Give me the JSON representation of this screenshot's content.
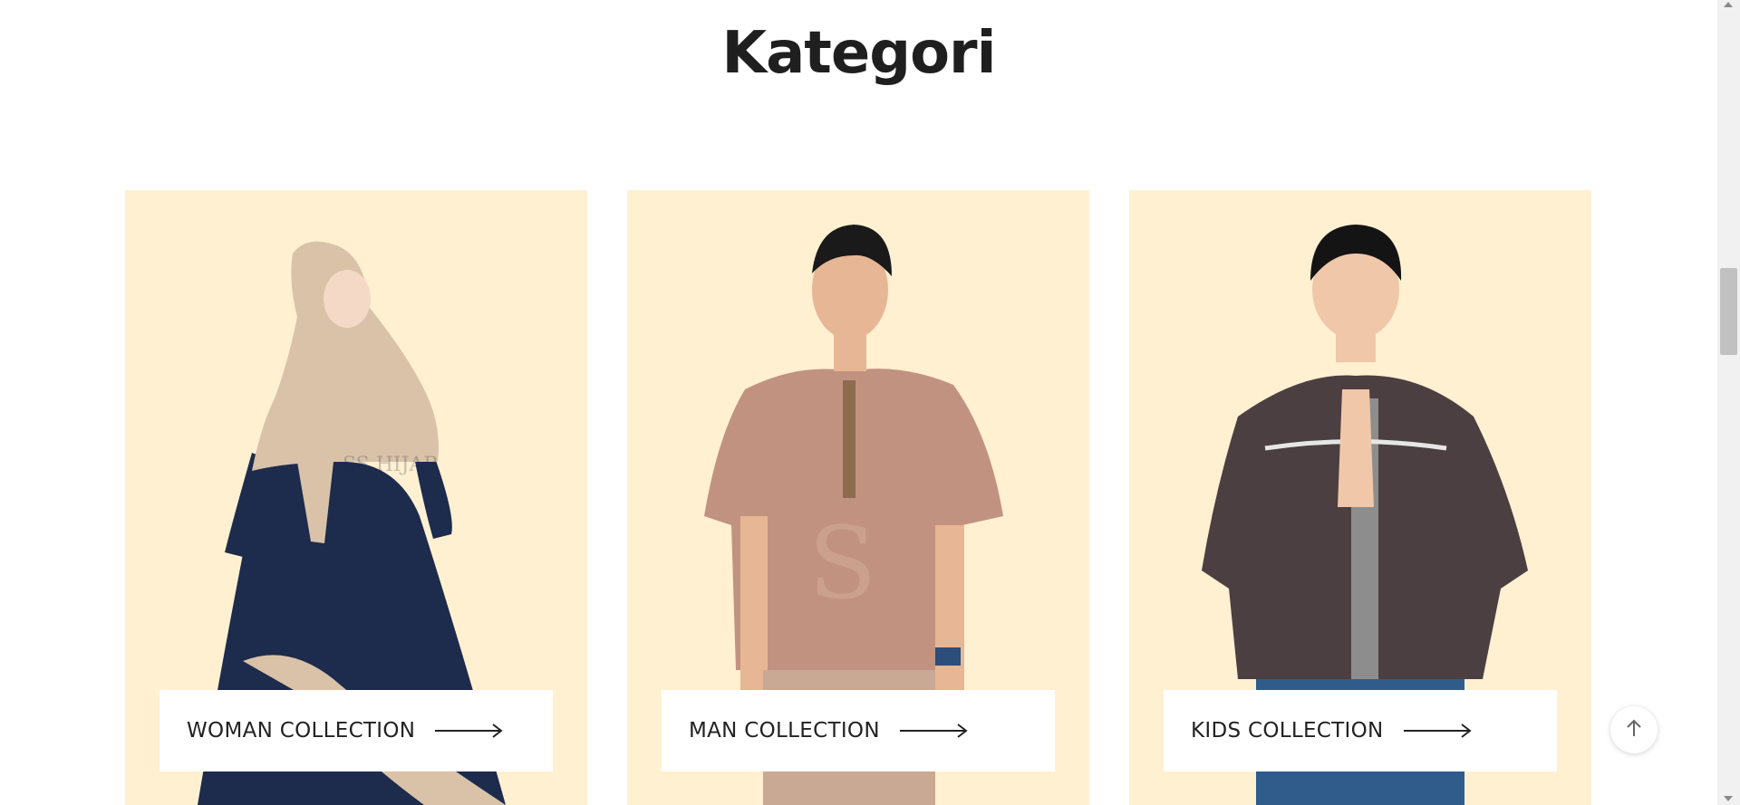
{
  "section": {
    "title": "Kategori"
  },
  "categories": [
    {
      "label": "WOMAN COLLECTION",
      "icon": "arrow-right-icon"
    },
    {
      "label": "MAN COLLECTION",
      "icon": "arrow-right-icon"
    },
    {
      "label": "KIDS COLLECTION",
      "icon": "arrow-right-icon"
    }
  ],
  "colors": {
    "card_background": "#fff0d1",
    "button_background": "#ffffff",
    "title_text": "#1f1f1f"
  },
  "back_to_top": {
    "icon": "arrow-up-icon"
  }
}
